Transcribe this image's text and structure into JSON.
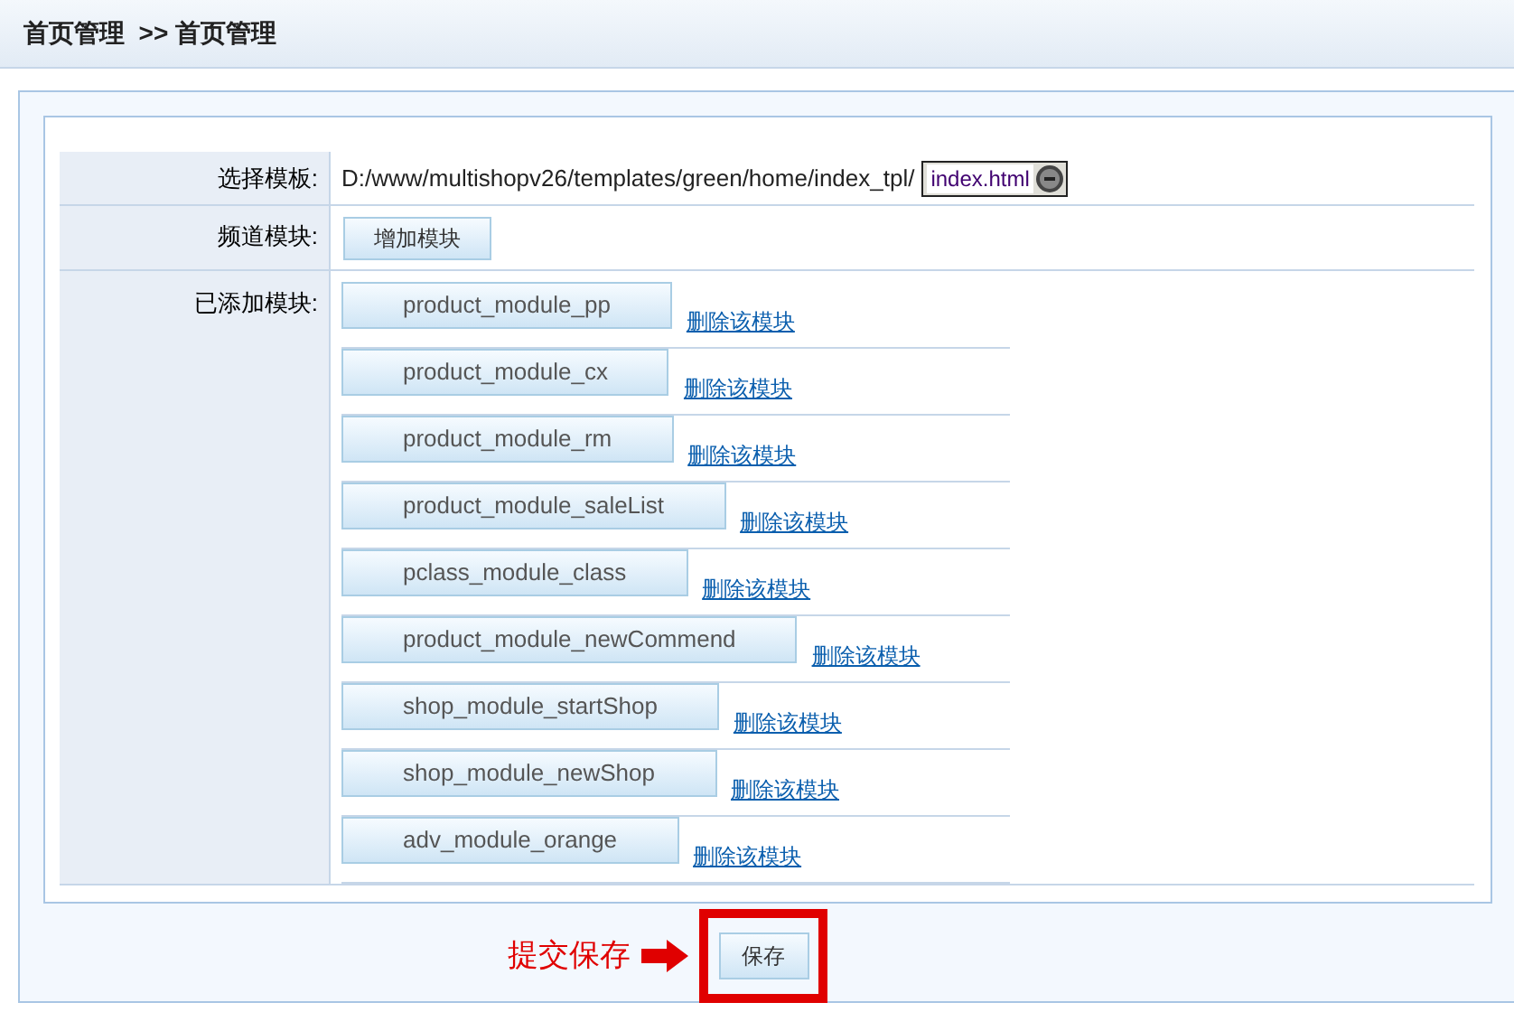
{
  "header": {
    "title": "首页管理  >> 首页管理"
  },
  "form": {
    "template_row": {
      "label": "选择模板:",
      "path": "D:/www/multishopv26/templates/green/home/index_tpl/",
      "select_value": "index.html"
    },
    "channel_row": {
      "label": "频道模块:",
      "button": "增加模块"
    },
    "modules_row": {
      "label": "已添加模块:",
      "modules": [
        {
          "name": "product_module_pp",
          "delete": "删除该模块"
        },
        {
          "name": "product_module_cx",
          "delete": "删除该模块"
        },
        {
          "name": "product_module_rm",
          "delete": "删除该模块"
        },
        {
          "name": "product_module_saleList",
          "delete": "删除该模块"
        },
        {
          "name": "pclass_module_class",
          "delete": "删除该模块"
        },
        {
          "name": "product_module_newCommend",
          "delete": "删除该模块"
        },
        {
          "name": "shop_module_startShop",
          "delete": "删除该模块"
        },
        {
          "name": "shop_module_newShop",
          "delete": "删除该模块"
        },
        {
          "name": "adv_module_orange",
          "delete": "删除该模块"
        }
      ]
    }
  },
  "annotation": {
    "text": "提交保存"
  },
  "save_button": "保存"
}
